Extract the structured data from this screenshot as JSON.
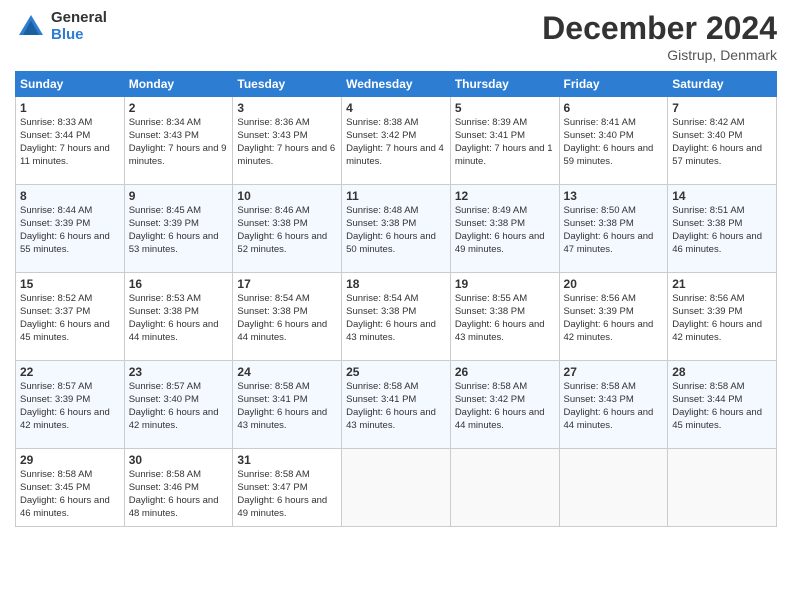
{
  "header": {
    "logo_line1": "General",
    "logo_line2": "Blue",
    "month": "December 2024",
    "location": "Gistrup, Denmark"
  },
  "days_of_week": [
    "Sunday",
    "Monday",
    "Tuesday",
    "Wednesday",
    "Thursday",
    "Friday",
    "Saturday"
  ],
  "weeks": [
    [
      {
        "day": "1",
        "sunrise": "8:33 AM",
        "sunset": "3:44 PM",
        "daylight": "7 hours and 11 minutes."
      },
      {
        "day": "2",
        "sunrise": "8:34 AM",
        "sunset": "3:43 PM",
        "daylight": "7 hours and 9 minutes."
      },
      {
        "day": "3",
        "sunrise": "8:36 AM",
        "sunset": "3:43 PM",
        "daylight": "7 hours and 6 minutes."
      },
      {
        "day": "4",
        "sunrise": "8:38 AM",
        "sunset": "3:42 PM",
        "daylight": "7 hours and 4 minutes."
      },
      {
        "day": "5",
        "sunrise": "8:39 AM",
        "sunset": "3:41 PM",
        "daylight": "7 hours and 1 minute."
      },
      {
        "day": "6",
        "sunrise": "8:41 AM",
        "sunset": "3:40 PM",
        "daylight": "6 hours and 59 minutes."
      },
      {
        "day": "7",
        "sunrise": "8:42 AM",
        "sunset": "3:40 PM",
        "daylight": "6 hours and 57 minutes."
      }
    ],
    [
      {
        "day": "8",
        "sunrise": "8:44 AM",
        "sunset": "3:39 PM",
        "daylight": "6 hours and 55 minutes."
      },
      {
        "day": "9",
        "sunrise": "8:45 AM",
        "sunset": "3:39 PM",
        "daylight": "6 hours and 53 minutes."
      },
      {
        "day": "10",
        "sunrise": "8:46 AM",
        "sunset": "3:38 PM",
        "daylight": "6 hours and 52 minutes."
      },
      {
        "day": "11",
        "sunrise": "8:48 AM",
        "sunset": "3:38 PM",
        "daylight": "6 hours and 50 minutes."
      },
      {
        "day": "12",
        "sunrise": "8:49 AM",
        "sunset": "3:38 PM",
        "daylight": "6 hours and 49 minutes."
      },
      {
        "day": "13",
        "sunrise": "8:50 AM",
        "sunset": "3:38 PM",
        "daylight": "6 hours and 47 minutes."
      },
      {
        "day": "14",
        "sunrise": "8:51 AM",
        "sunset": "3:38 PM",
        "daylight": "6 hours and 46 minutes."
      }
    ],
    [
      {
        "day": "15",
        "sunrise": "8:52 AM",
        "sunset": "3:37 PM",
        "daylight": "6 hours and 45 minutes."
      },
      {
        "day": "16",
        "sunrise": "8:53 AM",
        "sunset": "3:38 PM",
        "daylight": "6 hours and 44 minutes."
      },
      {
        "day": "17",
        "sunrise": "8:54 AM",
        "sunset": "3:38 PM",
        "daylight": "6 hours and 44 minutes."
      },
      {
        "day": "18",
        "sunrise": "8:54 AM",
        "sunset": "3:38 PM",
        "daylight": "6 hours and 43 minutes."
      },
      {
        "day": "19",
        "sunrise": "8:55 AM",
        "sunset": "3:38 PM",
        "daylight": "6 hours and 43 minutes."
      },
      {
        "day": "20",
        "sunrise": "8:56 AM",
        "sunset": "3:39 PM",
        "daylight": "6 hours and 42 minutes."
      },
      {
        "day": "21",
        "sunrise": "8:56 AM",
        "sunset": "3:39 PM",
        "daylight": "6 hours and 42 minutes."
      }
    ],
    [
      {
        "day": "22",
        "sunrise": "8:57 AM",
        "sunset": "3:39 PM",
        "daylight": "6 hours and 42 minutes."
      },
      {
        "day": "23",
        "sunrise": "8:57 AM",
        "sunset": "3:40 PM",
        "daylight": "6 hours and 42 minutes."
      },
      {
        "day": "24",
        "sunrise": "8:58 AM",
        "sunset": "3:41 PM",
        "daylight": "6 hours and 43 minutes."
      },
      {
        "day": "25",
        "sunrise": "8:58 AM",
        "sunset": "3:41 PM",
        "daylight": "6 hours and 43 minutes."
      },
      {
        "day": "26",
        "sunrise": "8:58 AM",
        "sunset": "3:42 PM",
        "daylight": "6 hours and 44 minutes."
      },
      {
        "day": "27",
        "sunrise": "8:58 AM",
        "sunset": "3:43 PM",
        "daylight": "6 hours and 44 minutes."
      },
      {
        "day": "28",
        "sunrise": "8:58 AM",
        "sunset": "3:44 PM",
        "daylight": "6 hours and 45 minutes."
      }
    ],
    [
      {
        "day": "29",
        "sunrise": "8:58 AM",
        "sunset": "3:45 PM",
        "daylight": "6 hours and 46 minutes."
      },
      {
        "day": "30",
        "sunrise": "8:58 AM",
        "sunset": "3:46 PM",
        "daylight": "6 hours and 48 minutes."
      },
      {
        "day": "31",
        "sunrise": "8:58 AM",
        "sunset": "3:47 PM",
        "daylight": "6 hours and 49 minutes."
      },
      {
        "day": "",
        "sunrise": "",
        "sunset": "",
        "daylight": ""
      },
      {
        "day": "",
        "sunrise": "",
        "sunset": "",
        "daylight": ""
      },
      {
        "day": "",
        "sunrise": "",
        "sunset": "",
        "daylight": ""
      },
      {
        "day": "",
        "sunrise": "",
        "sunset": "",
        "daylight": ""
      }
    ]
  ]
}
